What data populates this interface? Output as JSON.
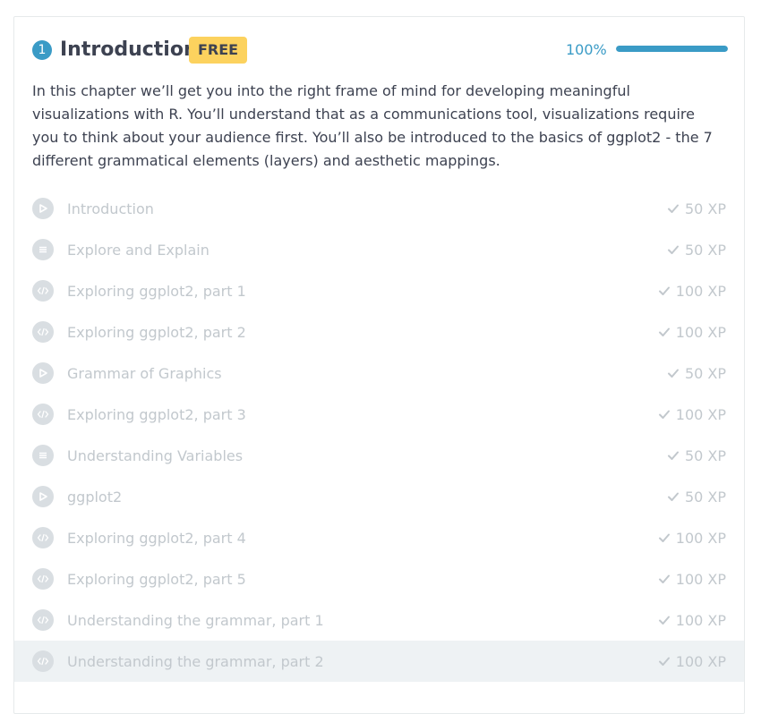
{
  "chapter": {
    "number": "1",
    "title": "Introduction",
    "badge": "FREE",
    "progress_text": "100%",
    "progress_value": 1.0,
    "description": "In this chapter we’ll get you into the right frame of mind for developing meaningful visualizations with R. You’ll understand that as a communications tool, visualizations require you to think about your audience first. You’ll also be introduced to the basics of ggplot2 - the 7 different grammatical elements (layers) and aesthetic mappings."
  },
  "exercises": [
    {
      "label": "Introduction",
      "xp": "50 XP",
      "icon": "video-icon"
    },
    {
      "label": "Explore and Explain",
      "xp": "50 XP",
      "icon": "multiple-choice-icon"
    },
    {
      "label": "Exploring ggplot2, part 1",
      "xp": "100 XP",
      "icon": "code-icon"
    },
    {
      "label": "Exploring ggplot2, part 2",
      "xp": "100 XP",
      "icon": "code-icon"
    },
    {
      "label": "Grammar of Graphics",
      "xp": "50 XP",
      "icon": "video-icon"
    },
    {
      "label": "Exploring ggplot2, part 3",
      "xp": "100 XP",
      "icon": "code-icon"
    },
    {
      "label": "Understanding Variables",
      "xp": "50 XP",
      "icon": "multiple-choice-icon"
    },
    {
      "label": "ggplot2",
      "xp": "50 XP",
      "icon": "video-icon"
    },
    {
      "label": "Exploring ggplot2, part 4",
      "xp": "100 XP",
      "icon": "code-icon"
    },
    {
      "label": "Exploring ggplot2, part 5",
      "xp": "100 XP",
      "icon": "code-icon"
    },
    {
      "label": "Understanding the grammar, part 1",
      "xp": "100 XP",
      "icon": "code-icon"
    },
    {
      "label": "Understanding the grammar, part 2",
      "xp": "100 XP",
      "icon": "code-icon"
    }
  ],
  "colors": {
    "accent": "#3a9bc6",
    "badge": "#fcd25e",
    "muted_text": "#c2c8cd",
    "active_row": "#eef2f4"
  }
}
